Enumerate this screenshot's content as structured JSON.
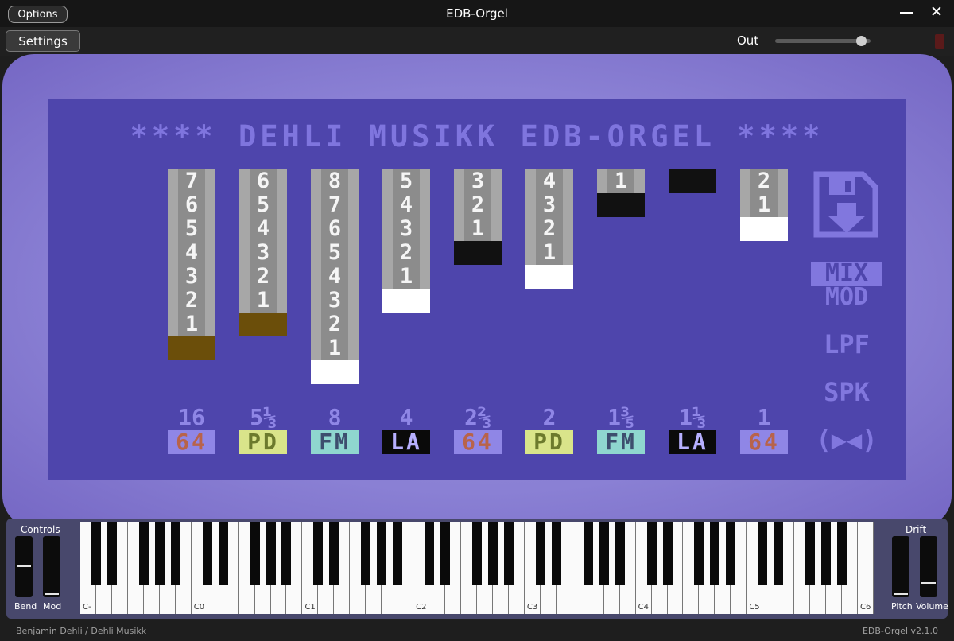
{
  "window": {
    "title": "EDB-Orgel",
    "options_label": "Options"
  },
  "toolbar": {
    "settings_label": "Settings",
    "out_label": "Out",
    "out_level": 0.9
  },
  "screen": {
    "banner": "**** DEHLI MUSIKK EDB-ORGEL ****",
    "drawbars": [
      {
        "footage": "16",
        "digits": [
          "7",
          "6",
          "5",
          "4",
          "3",
          "2",
          "1"
        ],
        "cap_color": "#6b4e0a",
        "wave": "64",
        "wave_fg": "#b8634a",
        "wave_bg": "#8f86e6"
      },
      {
        "footage": "5⅓",
        "digits": [
          "6",
          "5",
          "4",
          "3",
          "2",
          "1"
        ],
        "cap_color": "#6b4e0a",
        "wave": "PD",
        "wave_fg": "#6c7a2d",
        "wave_bg": "#d9e48a"
      },
      {
        "footage": "8",
        "digits": [
          "8",
          "7",
          "6",
          "5",
          "4",
          "3",
          "2",
          "1"
        ],
        "cap_color": "#ffffff",
        "wave": "FM",
        "wave_fg": "#3d4d6e",
        "wave_bg": "#8fd6cf"
      },
      {
        "footage": "4",
        "digits": [
          "5",
          "4",
          "3",
          "2",
          "1"
        ],
        "cap_color": "#ffffff",
        "wave": "LA",
        "wave_fg": "#b7b0ff",
        "wave_bg": "#0a0a0a"
      },
      {
        "footage": "2⅔",
        "digits": [
          "3",
          "2",
          "1"
        ],
        "cap_color": "#111111",
        "wave": "64",
        "wave_fg": "#b8634a",
        "wave_bg": "#8f86e6"
      },
      {
        "footage": "2",
        "digits": [
          "4",
          "3",
          "2",
          "1"
        ],
        "cap_color": "#ffffff",
        "wave": "PD",
        "wave_fg": "#6c7a2d",
        "wave_bg": "#d9e48a"
      },
      {
        "footage": "1⅗",
        "digits": [
          "1"
        ],
        "cap_color": "#111111",
        "wave": "FM",
        "wave_fg": "#3d4d6e",
        "wave_bg": "#8fd6cf"
      },
      {
        "footage": "1⅓",
        "digits": [],
        "cap_color": "#111111",
        "wave": "LA",
        "wave_fg": "#b7b0ff",
        "wave_bg": "#0a0a0a"
      },
      {
        "footage": "1",
        "digits": [
          "2",
          "1"
        ],
        "cap_color": "#ffffff",
        "wave": "64",
        "wave_fg": "#b8634a",
        "wave_bg": "#8f86e6"
      }
    ],
    "side": {
      "mix": "MIX",
      "mod": "MOD",
      "lpf": "LPF",
      "spk": "SPK",
      "speaker": "(▶◀)",
      "save_icon": "floppy-disk-icon"
    }
  },
  "controls": {
    "title": "Controls",
    "bend": "Bend",
    "mod": "Mod",
    "bend_value": 0.5,
    "mod_value": 0.0
  },
  "drift": {
    "title": "Drift",
    "pitch": "Pitch",
    "volume": "Volume",
    "pitch_value": 0.0,
    "volume_value": 0.2
  },
  "keyboard": {
    "octave_labels": [
      "C-",
      "C0",
      "C1",
      "C2",
      "C3",
      "C4",
      "C5",
      "C6"
    ]
  },
  "footer": {
    "credit": "Benjamin Dehli  /  Dehli Musikk",
    "version": "EDB-Orgel  v2.1.0"
  }
}
